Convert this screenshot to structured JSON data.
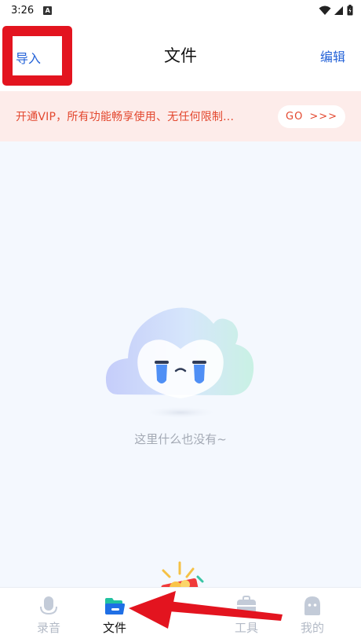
{
  "status_bar": {
    "time": "3:26",
    "notification_glyph": "A",
    "icons": [
      "wifi-icon",
      "signal-icon",
      "battery-icon"
    ]
  },
  "header": {
    "import_label": "导入",
    "title": "文件",
    "edit_label": "编辑"
  },
  "vip_banner": {
    "text": "开通VIP，所有功能畅享使用、无任何限制...",
    "button_label": "GO",
    "button_arrows": ">>>"
  },
  "empty_state": {
    "icon": "crying-cloud-icon",
    "message": "这里什么也没有~"
  },
  "bottom_nav": {
    "items": [
      {
        "label": "录音",
        "icon": "microphone-icon",
        "active": false
      },
      {
        "label": "文件",
        "icon": "folder-icon",
        "active": true
      },
      {
        "label": "工具",
        "icon": "toolbox-icon",
        "active": false
      },
      {
        "label": "我的",
        "icon": "profile-icon",
        "active": false
      }
    ]
  },
  "colors": {
    "accent_blue": "#2563d8",
    "vip_text": "#e3482f",
    "vip_background": "#fdecea",
    "page_background": "#f4f8fe",
    "annotation_red": "#e3141f",
    "inactive_nav": "#b3bac6"
  }
}
